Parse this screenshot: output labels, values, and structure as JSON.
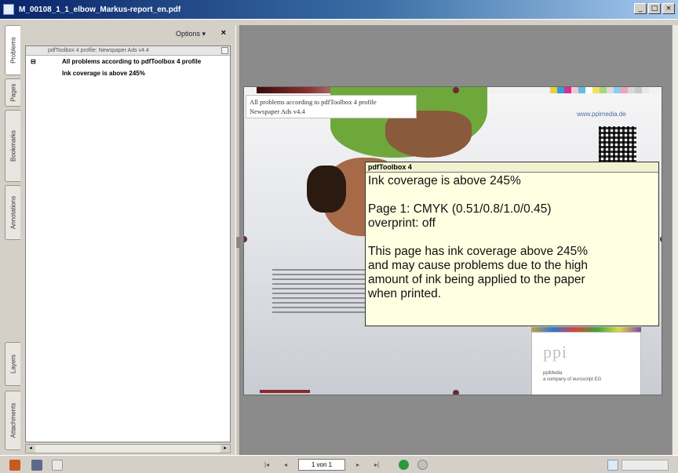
{
  "window": {
    "title": "M_00108_1_1_elbow_Markus-report_en.pdf",
    "minimize": "_",
    "maximize": "□",
    "close": "×"
  },
  "nav_tabs": [
    {
      "label": "Problems"
    },
    {
      "label": "Pages"
    },
    {
      "label": "Bookmarks"
    },
    {
      "label": "Annotations"
    },
    {
      "label": "Layers"
    },
    {
      "label": "Attachments"
    }
  ],
  "panel": {
    "options_label": "Options ▾",
    "close_label": "×",
    "tree_header": "pdfToolbox 4 profile: Newspaper Ads v4.4",
    "rows": [
      {
        "twisty": "⊟",
        "label": "All problems according to pdfToolbox 4 profile"
      },
      {
        "twisty": "",
        "label": "Ink coverage is above 245%"
      }
    ]
  },
  "page": {
    "hint_line1": "All problems according to pdfToolbox 4 profile",
    "hint_line2": "Newspaper Ads v4.4",
    "url": "www.ppimedia.de",
    "logo": "ppi",
    "logo_sub1": "ppiMedia",
    "logo_sub2": "a company of euroscript EG"
  },
  "tooltip": {
    "header": "pdfToolbox 4",
    "line1": "Ink coverage is above 245%",
    "line2": "Page 1: CMYK (0.51/0.8/1.0/0.45)",
    "line3": "overprint: off",
    "line4": "This page has ink coverage above 245%",
    "line5": "and may cause problems due to the high",
    "line6": "amount of ink being applied to the paper",
    "line7": "when printed."
  },
  "statusbar": {
    "page_field": "1 von 1",
    "first": "|◂",
    "prev": "◂",
    "next": "▸",
    "last": "▸|"
  },
  "colors": {
    "titlebar_start": "#0a246a",
    "tooltip_bg": "#ffffe1",
    "viewer_bg": "#8b8b8b",
    "link": "#4a6ea8"
  }
}
